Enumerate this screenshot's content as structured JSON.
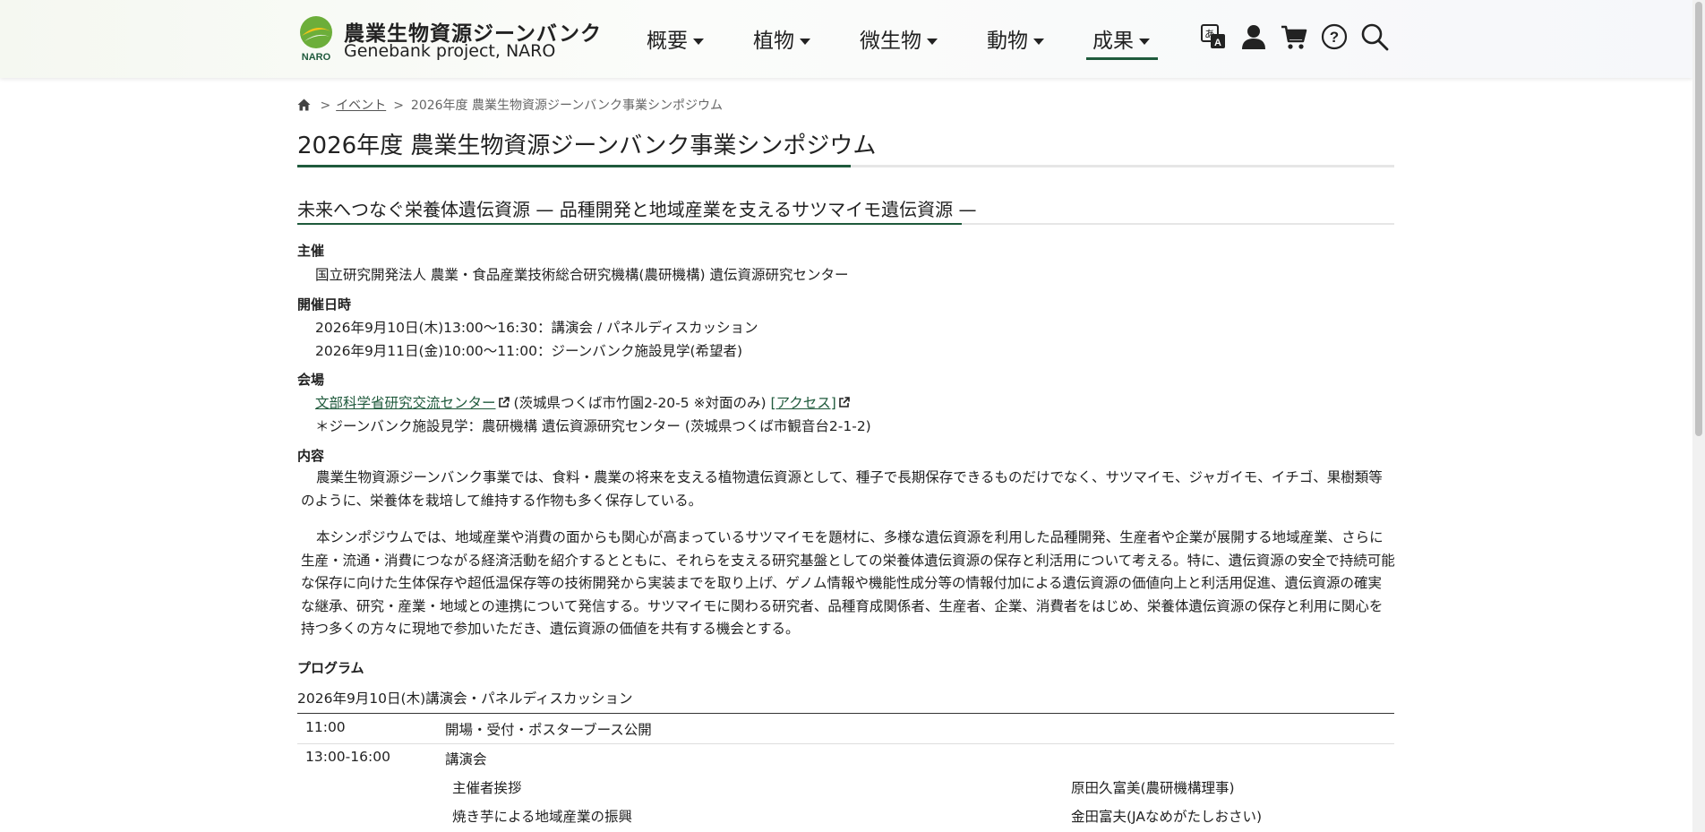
{
  "header": {
    "site_name": "農業生物資源ジーンバンク",
    "site_sub": "Genebank project, NARO",
    "logo_text": "NARO",
    "nav": [
      {
        "label": "概要"
      },
      {
        "label": "植物"
      },
      {
        "label": "微生物"
      },
      {
        "label": "動物"
      },
      {
        "label": "成果"
      }
    ],
    "icons": [
      "translate-icon",
      "user-icon",
      "cart-icon",
      "help-icon",
      "search-icon"
    ],
    "accent_color": "#1f5a3c"
  },
  "breadcrumb": {
    "sep": ">",
    "events": "イベント",
    "current": "2026年度 農業生物資源ジーンバンク事業シンポジウム"
  },
  "page": {
    "title": "2026年度 農業生物資源ジーンバンク事業シンポジウム",
    "subtitle": "未来へつなぐ栄養体遺伝資源 — 品種開発と地域産業を支えるサツマイモ遺伝資源 —"
  },
  "details": {
    "organizer_label": "主催",
    "organizer": "国立研究開発法人 農業・食品産業技術総合研究機構(農研機構) 遺伝資源研究センター",
    "date_label": "開催日時",
    "date1": "2026年9月10日(木)13:00～16:30：講演会 / パネルディスカッション",
    "date2": "2026年9月11日(金)10:00～11:00：ジーンバンク施設見学(希望者)",
    "venue_label": "会場",
    "venue_link": "文部科学省研究交流センター",
    "venue_addr": " (茨城県つくば市竹園2-20-5 ※対面のみ) ",
    "access_link": "[アクセス]",
    "venue_note": "＊ジーンバンク施設見学：農研機構 遺伝資源研究センター (茨城県つくば市観音台2-1-2)",
    "content_label": "内容",
    "content_p1": "農業生物資源ジーンバンク事業では、食料・農業の将来を支える植物遺伝資源として、種子で長期保存できるものだけでなく、サツマイモ、ジャガイモ、イチゴ、果樹類等のように、栄養体を栽培して維持する作物も多く保存している。",
    "content_p2": "本シンポジウムでは、地域産業や消費の面からも関心が高まっているサツマイモを題材に、多様な遺伝資源を利用した品種開発、生産者や企業が展開する地域産業、さらに生産・流通・消費につながる経済活動を紹介するとともに、それらを支える研究基盤としての栄養体遺伝資源の保存と利活用について考える。特に、遺伝資源の安全で持続可能な保存に向けた生体保存や超低温保存等の技術開発から実装までを取り上げ、ゲノム情報や機能性成分等の情報付加による遺伝資源の価値向上と利活用促進、遺伝資源の確実な継承、研究・産業・地域との連携について発信する。サツマイモに関わる研究者、品種育成関係者、生産者、企業、消費者をはじめ、栄養体遺伝資源の保存と利用に関心を持つ多くの方々に現地で参加いただき、遺伝資源の価値を共有する機会とする。"
  },
  "program": {
    "label": "プログラム",
    "date": "2026年9月10日(木)講演会・パネルディスカッション",
    "rows": [
      {
        "time": "11:00",
        "item": "開場・受付・ポスターブース公開"
      },
      {
        "time": "13:00-16:00",
        "item": "講演会"
      }
    ],
    "talks": [
      {
        "title": "主催者挨拶",
        "speaker": "原田久富美(農研機構理事)"
      },
      {
        "title": "焼き芋による地域産業の振興",
        "speaker": "金田富夫(JAなめがたしおさい)"
      }
    ]
  }
}
